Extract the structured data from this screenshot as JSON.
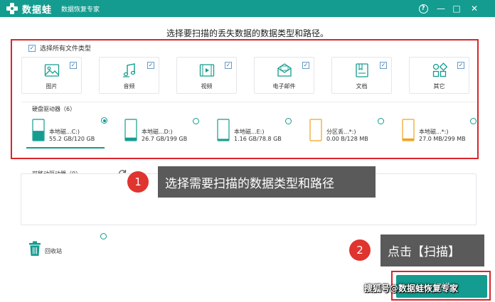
{
  "titlebar": {
    "app_name": "数据蛙",
    "app_subtitle": "数据恢复专家",
    "help_symbol": "?",
    "min_symbol": "—",
    "max_symbol": "□",
    "close_symbol": "✕",
    "bg_color": "#139c8f"
  },
  "headline": "选择要扫描的丢失数据的数据类型和路径。",
  "select_all": {
    "label": "选择所有文件类型",
    "checked": true
  },
  "file_types": [
    {
      "label": "图片",
      "icon": "image-icon",
      "checked": true
    },
    {
      "label": "音频",
      "icon": "music-icon",
      "checked": true
    },
    {
      "label": "视频",
      "icon": "video-icon",
      "checked": true
    },
    {
      "label": "电子邮件",
      "icon": "email-icon",
      "checked": true
    },
    {
      "label": "文档",
      "icon": "document-icon",
      "checked": true
    },
    {
      "label": "其它",
      "icon": "other-icon",
      "checked": true
    }
  ],
  "hard_drives": {
    "label": "硬盘驱动器（6）",
    "disks": [
      {
        "name": "本地磁...C:)",
        "size": "55.2 GB/120 GB",
        "selected": true,
        "fill": 0.46,
        "color": "#139c8f",
        "icon": "system-disk-icon"
      },
      {
        "name": "本地磁...D:)",
        "size": "26.7 GB/199 GB",
        "selected": false,
        "fill": 0.13,
        "color": "#139c8f",
        "icon": "disk-icon"
      },
      {
        "name": "本地磁...E:)",
        "size": "1.16 GB/78.8 GB",
        "selected": false,
        "fill": 0.01,
        "color": "#139c8f",
        "icon": "disk-icon"
      },
      {
        "name": "分区丢...*:)",
        "size": "0.00  B/128 MB",
        "selected": false,
        "fill": 0.0,
        "color": "#f0a21c",
        "icon": "lost-partition-icon"
      },
      {
        "name": "本地磁...*:)",
        "size": "27.0 MB/299 MB",
        "selected": false,
        "fill": 0.09,
        "color": "#f0a21c",
        "icon": "disk-icon"
      }
    ]
  },
  "removable": {
    "label": "可移动驱动器（0）"
  },
  "recycle_bin": {
    "label": "回收站"
  },
  "annotations": {
    "step1_number": "1",
    "step1_text": "选择需要扫描的数据类型和路径",
    "step2_number": "2",
    "step2_text": "点击【扫描】"
  },
  "scan_button": {
    "label": "扫描"
  },
  "watermark": "搜狐号@数据蛙恢复专家",
  "colors": {
    "accent": "#139c8f",
    "highlight": "#d9252a",
    "badge": "#e0342f",
    "callout": "#5a5a5a"
  }
}
